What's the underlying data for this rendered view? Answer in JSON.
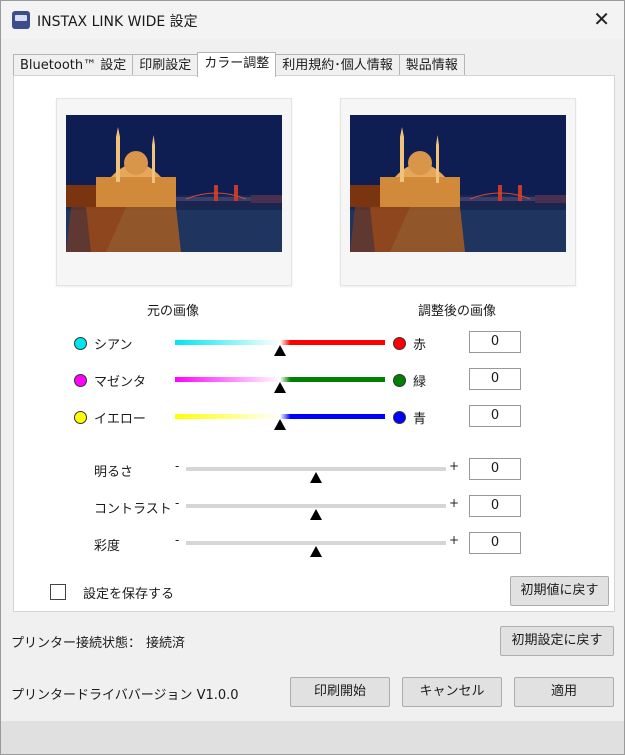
{
  "window": {
    "title": "INSTAX LINK WIDE 設定",
    "close_icon": "close-icon"
  },
  "tabs": [
    {
      "label": "Bluetooth™ 設定"
    },
    {
      "label": "印刷設定"
    },
    {
      "label": "カラー調整"
    },
    {
      "label": "利用規約･個人情報"
    },
    {
      "label": "製品情報"
    }
  ],
  "preview": {
    "original_caption": "元の画像",
    "adjusted_caption": "調整後の画像"
  },
  "color_balance": [
    {
      "left_label": "シアン",
      "left_color": "#00e5f0",
      "right_label": "赤",
      "right_color": "#ff0000",
      "value": "0",
      "slider_fraction": 0.5
    },
    {
      "left_label": "マゼンタ",
      "left_color": "#ff00ff",
      "right_label": "緑",
      "right_color": "#008000",
      "value": "0",
      "slider_fraction": 0.5
    },
    {
      "left_label": "イエロー",
      "left_color": "#ffff00",
      "right_label": "青",
      "right_color": "#0000ff",
      "value": "0",
      "slider_fraction": 0.5
    }
  ],
  "adjustments": [
    {
      "label": "明るさ",
      "minus": "-",
      "plus": "+",
      "value": "0",
      "slider_fraction": 0.5
    },
    {
      "label": "コントラスト",
      "minus": "-",
      "plus": "+",
      "value": "0",
      "slider_fraction": 0.5
    },
    {
      "label": "彩度",
      "minus": "-",
      "plus": "+",
      "value": "0",
      "slider_fraction": 0.5
    }
  ],
  "save_settings_label": "設定を保存する",
  "reset_button": "初期値に戻す",
  "status": {
    "label": "プリンター接続状態：",
    "value": "接続済"
  },
  "factory_reset_button": "初期設定に戻す",
  "driver_version": "プリンタードライババージョン V1.0.0",
  "footer_buttons": {
    "print": "印刷開始",
    "cancel": "キャンセル",
    "apply": "適用"
  }
}
